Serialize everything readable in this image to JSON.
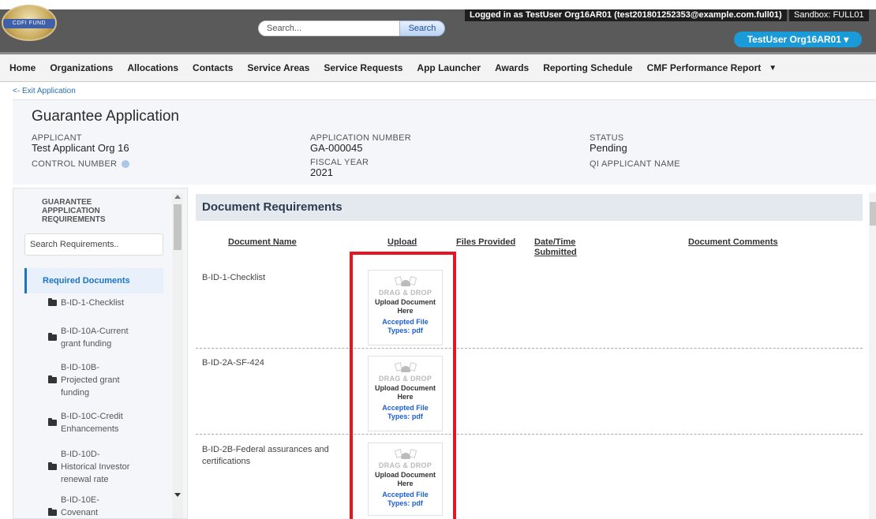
{
  "header": {
    "logo_text": "CDFI FUND",
    "search_placeholder": "Search...",
    "search_button": "Search",
    "logged_in_text": "Logged in as TestUser Org16AR01 (test201801252353@example.com.full01)",
    "sandbox_text": "Sandbox:  FULL01",
    "user_menu": "TestUser Org16AR01 ▾"
  },
  "nav": {
    "items": [
      "Home",
      "Organizations",
      "Allocations",
      "Contacts",
      "Service Areas",
      "Service Requests",
      "App Launcher",
      "Awards",
      "Reporting Schedule",
      "CMF Performance Report"
    ],
    "more": "▼"
  },
  "exit_link": "<- Exit Application",
  "application": {
    "title": "Guarantee Application",
    "fields": {
      "applicant_label": "APPLICANT",
      "applicant_value": "Test Applicant Org 16",
      "number_label": "APPLICATION NUMBER",
      "number_value": "GA-000045",
      "status_label": "STATUS",
      "status_value": "Pending",
      "control_label": "CONTROL NUMBER",
      "fiscal_label": "FISCAL YEAR",
      "fiscal_value": "2021",
      "qi_label": "QI APPLICANT NAME"
    }
  },
  "sidebar": {
    "heading_1": "GUARANTEE",
    "heading_2": "APPPLICATION",
    "heading_3": "REQUIREMENTS",
    "search_placeholder": "Search Requirements..",
    "active_item": "Required Documents",
    "items": [
      {
        "line1": "B-ID-1-Checklist",
        "line2": "",
        "line3": ""
      },
      {
        "line1": "B-ID-10A-Current",
        "line2": "grant funding",
        "line3": ""
      },
      {
        "line1": "B-ID-10B-",
        "line2": "Projected grant",
        "line3": "funding"
      },
      {
        "line1": "B-ID-10C-Credit",
        "line2": "Enhancements",
        "line3": ""
      },
      {
        "line1": "B-ID-10D-",
        "line2": "Historical Investor",
        "line3": "renewal rate"
      },
      {
        "line1": "B-ID-10E-",
        "line2": "Covenant",
        "line3": ""
      }
    ]
  },
  "main": {
    "section_title": "Document Requirements",
    "columns": {
      "name": "Document Name",
      "upload": "Upload",
      "files": "Files Provided",
      "date_1": "Date/Time",
      "date_2": "Submitted",
      "comments": "Document Comments"
    },
    "rows": [
      {
        "name_1": "B-ID-1-Checklist",
        "name_2": ""
      },
      {
        "name_1": "B-ID-2A-SF-424",
        "name_2": ""
      },
      {
        "name_1": "B-ID-2B-Federal assurances and",
        "name_2": "certifications"
      }
    ],
    "upload": {
      "drag": "DRAG & DROP",
      "line1": "Upload Document",
      "line2": "Here",
      "accepted_1": "Accepted File",
      "accepted_2": "Types: pdf"
    }
  }
}
